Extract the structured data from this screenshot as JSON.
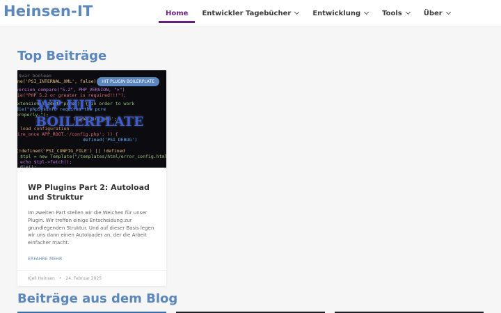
{
  "header": {
    "logo": "Heinsen-IT",
    "nav": [
      {
        "label": "Home",
        "active": true
      },
      {
        "label": "Entwickler Tagebücher",
        "dropdown": true
      },
      {
        "label": "Entwicklung",
        "dropdown": true
      },
      {
        "label": "Tools",
        "dropdown": true
      },
      {
        "label": "Über",
        "dropdown": true
      }
    ]
  },
  "top_section": {
    "title": "Top Beiträge",
    "post": {
      "badge": "HIT PLUGIN BOILERPLATE",
      "image_title_line1": "WP HIT",
      "image_title_line2": "BOILERPLATE",
      "title": "WP Plugins Part 2: Autoload und Struktur",
      "excerpt": "Im zweiten Part stellen wir die Weichen für unser Plugin. Wir treffen einige Entscheidung zur grundlegenden Struktur. Und auf dieser Basis legen wir uns dann einen Autoloader an, der die Arbeit einfacher macht.",
      "read_more": "ERFAHRE MEHR",
      "author": "Kjell Heinsen",
      "separator": "•",
      "date": "24. Februar 2025"
    }
  },
  "blog_section": {
    "title": "Beiträge aus dem Blog"
  },
  "colors": {
    "accent": "#5b87bd",
    "nav_active": "#6a1b7e",
    "image_bg": "#0b0b10"
  }
}
